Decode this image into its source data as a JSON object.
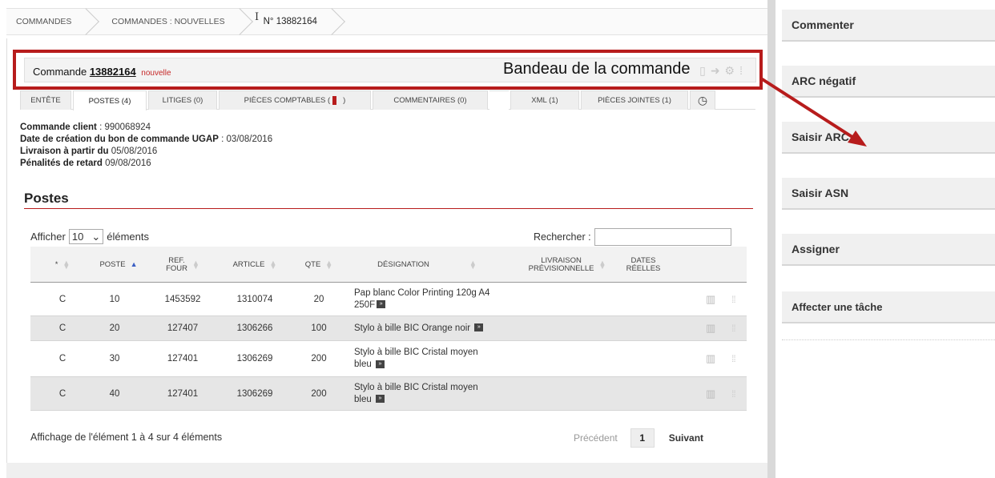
{
  "breadcrumb": {
    "items": [
      "Commandes",
      "Commandes : Nouvelles",
      "N° 13882164"
    ]
  },
  "order": {
    "label": "Commande",
    "number": "13882164",
    "status": "nouvelle"
  },
  "annotation": {
    "label": "Bandeau de la commande",
    "color": "#b71c1c"
  },
  "tabs": [
    {
      "label": "ENTÊTE"
    },
    {
      "label": "POSTES (4)"
    },
    {
      "label": "LITIGES (0)"
    },
    {
      "label": "PIÈCES COMPTABLES ("
    },
    {
      "label": ")"
    },
    {
      "label": "COMMENTAIRES (0)"
    },
    {
      "label": "XML (1)"
    },
    {
      "label": "PIÈCES JOINTES (1)"
    }
  ],
  "info": {
    "client_label": "Commande client",
    "client_value": ": 990068924",
    "creation_label": "Date de création du bon de commande UGAP",
    "creation_value": ": 03/08/2016",
    "delivery_label": "Livraison à partir du",
    "delivery_value": "05/08/2016",
    "penalty_label": "Pénalités de retard",
    "penalty_value": "09/08/2016"
  },
  "section": {
    "title": "Postes"
  },
  "table_controls": {
    "show_prefix": "Afficher",
    "show_value": "10",
    "show_suffix": "éléments",
    "search_label": "Rechercher :"
  },
  "table": {
    "headers": {
      "star": "*",
      "poste": "POSTE",
      "ref_line1": "REF.",
      "ref_line2": "FOUR",
      "article": "ARTICLE",
      "qte": "QTE",
      "designation": "DÉSIGNATION",
      "livraison_line1": "LIVRAISON",
      "livraison_line2": "PRÉVISIONNELLE",
      "dates_line1": "DATES",
      "dates_line2": "RÉELLES"
    },
    "rows": [
      {
        "star": "C",
        "poste": "10",
        "ref": "1453592",
        "article": "1310074",
        "qte": "20",
        "d1": "Pap blanc Color Printing 120g A4",
        "d2": "250F"
      },
      {
        "star": "C",
        "poste": "20",
        "ref": "127407",
        "article": "1306266",
        "qte": "100",
        "d1": "Stylo à bille BIC Orange noir",
        "d2": ""
      },
      {
        "star": "C",
        "poste": "30",
        "ref": "127401",
        "article": "1306269",
        "qte": "200",
        "d1": "Stylo à bille BIC Cristal moyen",
        "d2": "bleu"
      },
      {
        "star": "C",
        "poste": "40",
        "ref": "127401",
        "article": "1306269",
        "qte": "200",
        "d1": "Stylo à bille BIC Cristal moyen",
        "d2": "bleu"
      }
    ]
  },
  "footer": {
    "info": "Affichage de l'élément 1 à 4 sur 4 éléments",
    "prev": "Précédent",
    "page": "1",
    "next": "Suivant"
  },
  "sidebar": {
    "actions": [
      "Commenter",
      "ARC négatif",
      "Saisir ARC",
      "Saisir ASN",
      "Assigner",
      "Affecter une tâche"
    ]
  }
}
